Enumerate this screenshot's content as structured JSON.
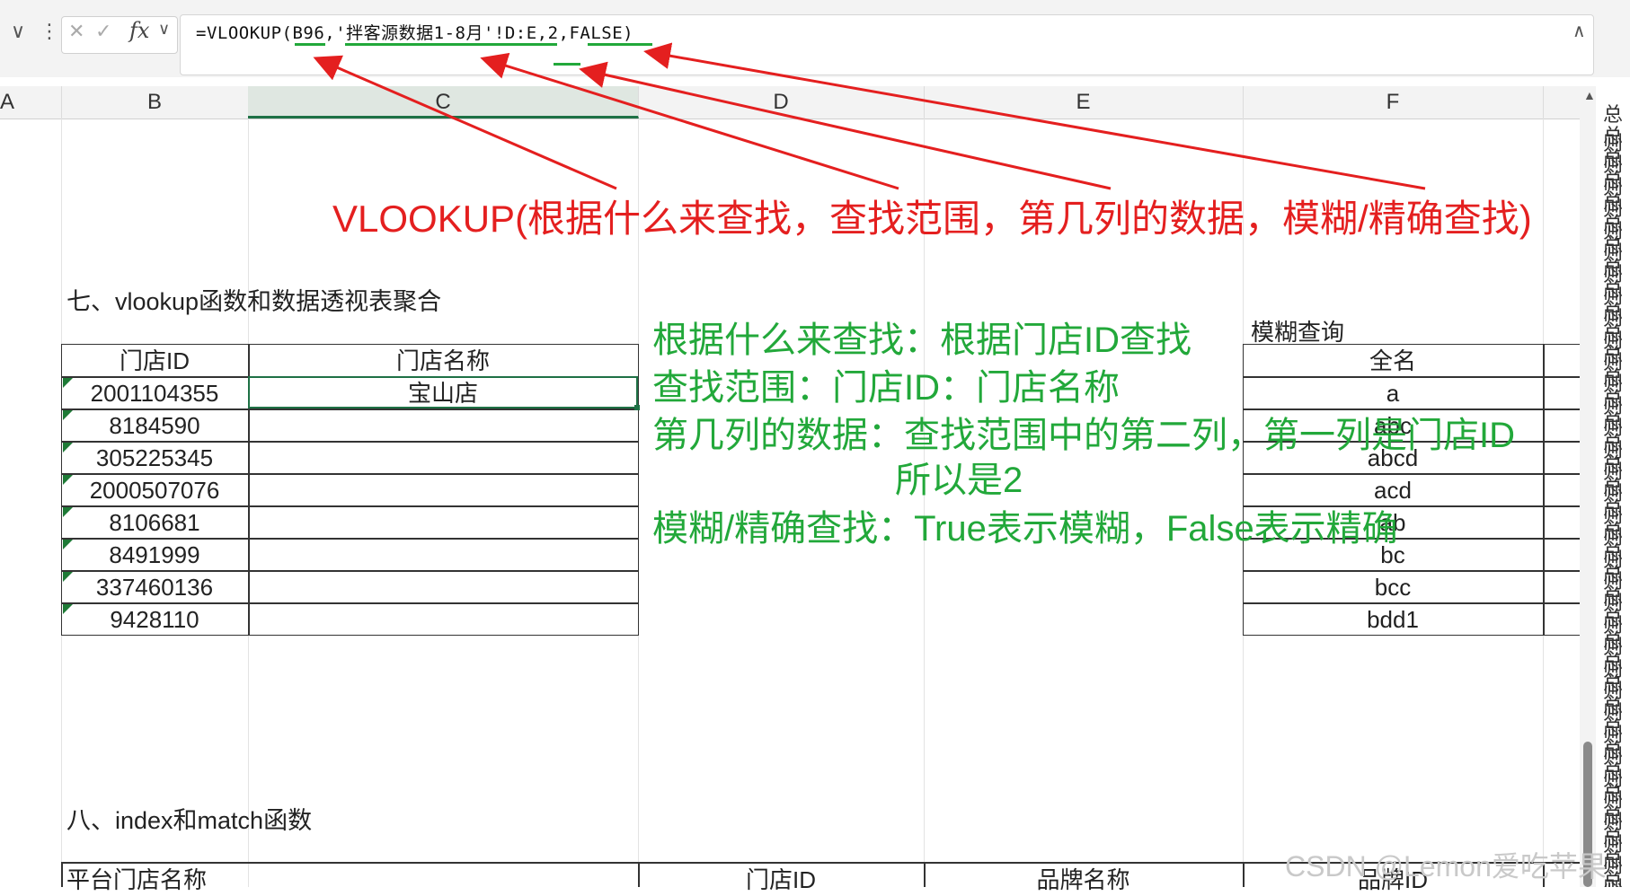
{
  "formula_bar": {
    "namebox_dropdown": "∨",
    "more": "⋮",
    "cancel": "✕",
    "confirm": "✓",
    "fx": "fx",
    "fx_dropdown": "∨",
    "formula": "=VLOOKUP(B96,'拌客源数据1-8月'!D:E,2,FALSE)",
    "collapse": "∧"
  },
  "columns": [
    "A",
    "B",
    "C",
    "D",
    "E",
    "F"
  ],
  "annotation": {
    "title": "VLOOKUP(根据什么来查找，查找范围，第几列的数据，模糊/精确查找)",
    "notes": [
      "根据什么来查找：根据门店ID查找",
      "查找范围：门店ID：门店名称",
      "第几列的数据：查找范围中的第二列，第一列是门店ID",
      "所以是2",
      "模糊/精确查找：True表示模糊，False表示精确"
    ]
  },
  "section7": {
    "title": "七、vlookup函数和数据透视表聚合",
    "headers": [
      "门店ID",
      "门店名称"
    ],
    "rows": [
      {
        "id": "2001104355",
        "name": "宝山店"
      },
      {
        "id": "8184590",
        "name": ""
      },
      {
        "id": "305225345",
        "name": ""
      },
      {
        "id": "2000507076",
        "name": ""
      },
      {
        "id": "8106681",
        "name": ""
      },
      {
        "id": "8491999",
        "name": ""
      },
      {
        "id": "337460136",
        "name": ""
      },
      {
        "id": "9428110",
        "name": ""
      }
    ]
  },
  "fuzzy": {
    "title": "模糊查询",
    "header": "全名",
    "values": [
      "a",
      "abc",
      "abcd",
      "acd",
      "ab",
      "bc",
      "bcc",
      "bdd1"
    ]
  },
  "section8": {
    "title": "八、index和match函数",
    "headers": [
      "平台门店名称",
      "门店ID",
      "品牌名称",
      "品牌ID"
    ]
  },
  "right_strip_char": "总则",
  "watermark": "CSDN @Lemon爱吃苹果",
  "colors": {
    "accent_green": "#22a83a",
    "arrow_red": "#e41f1f",
    "excel_green": "#1e7145"
  }
}
